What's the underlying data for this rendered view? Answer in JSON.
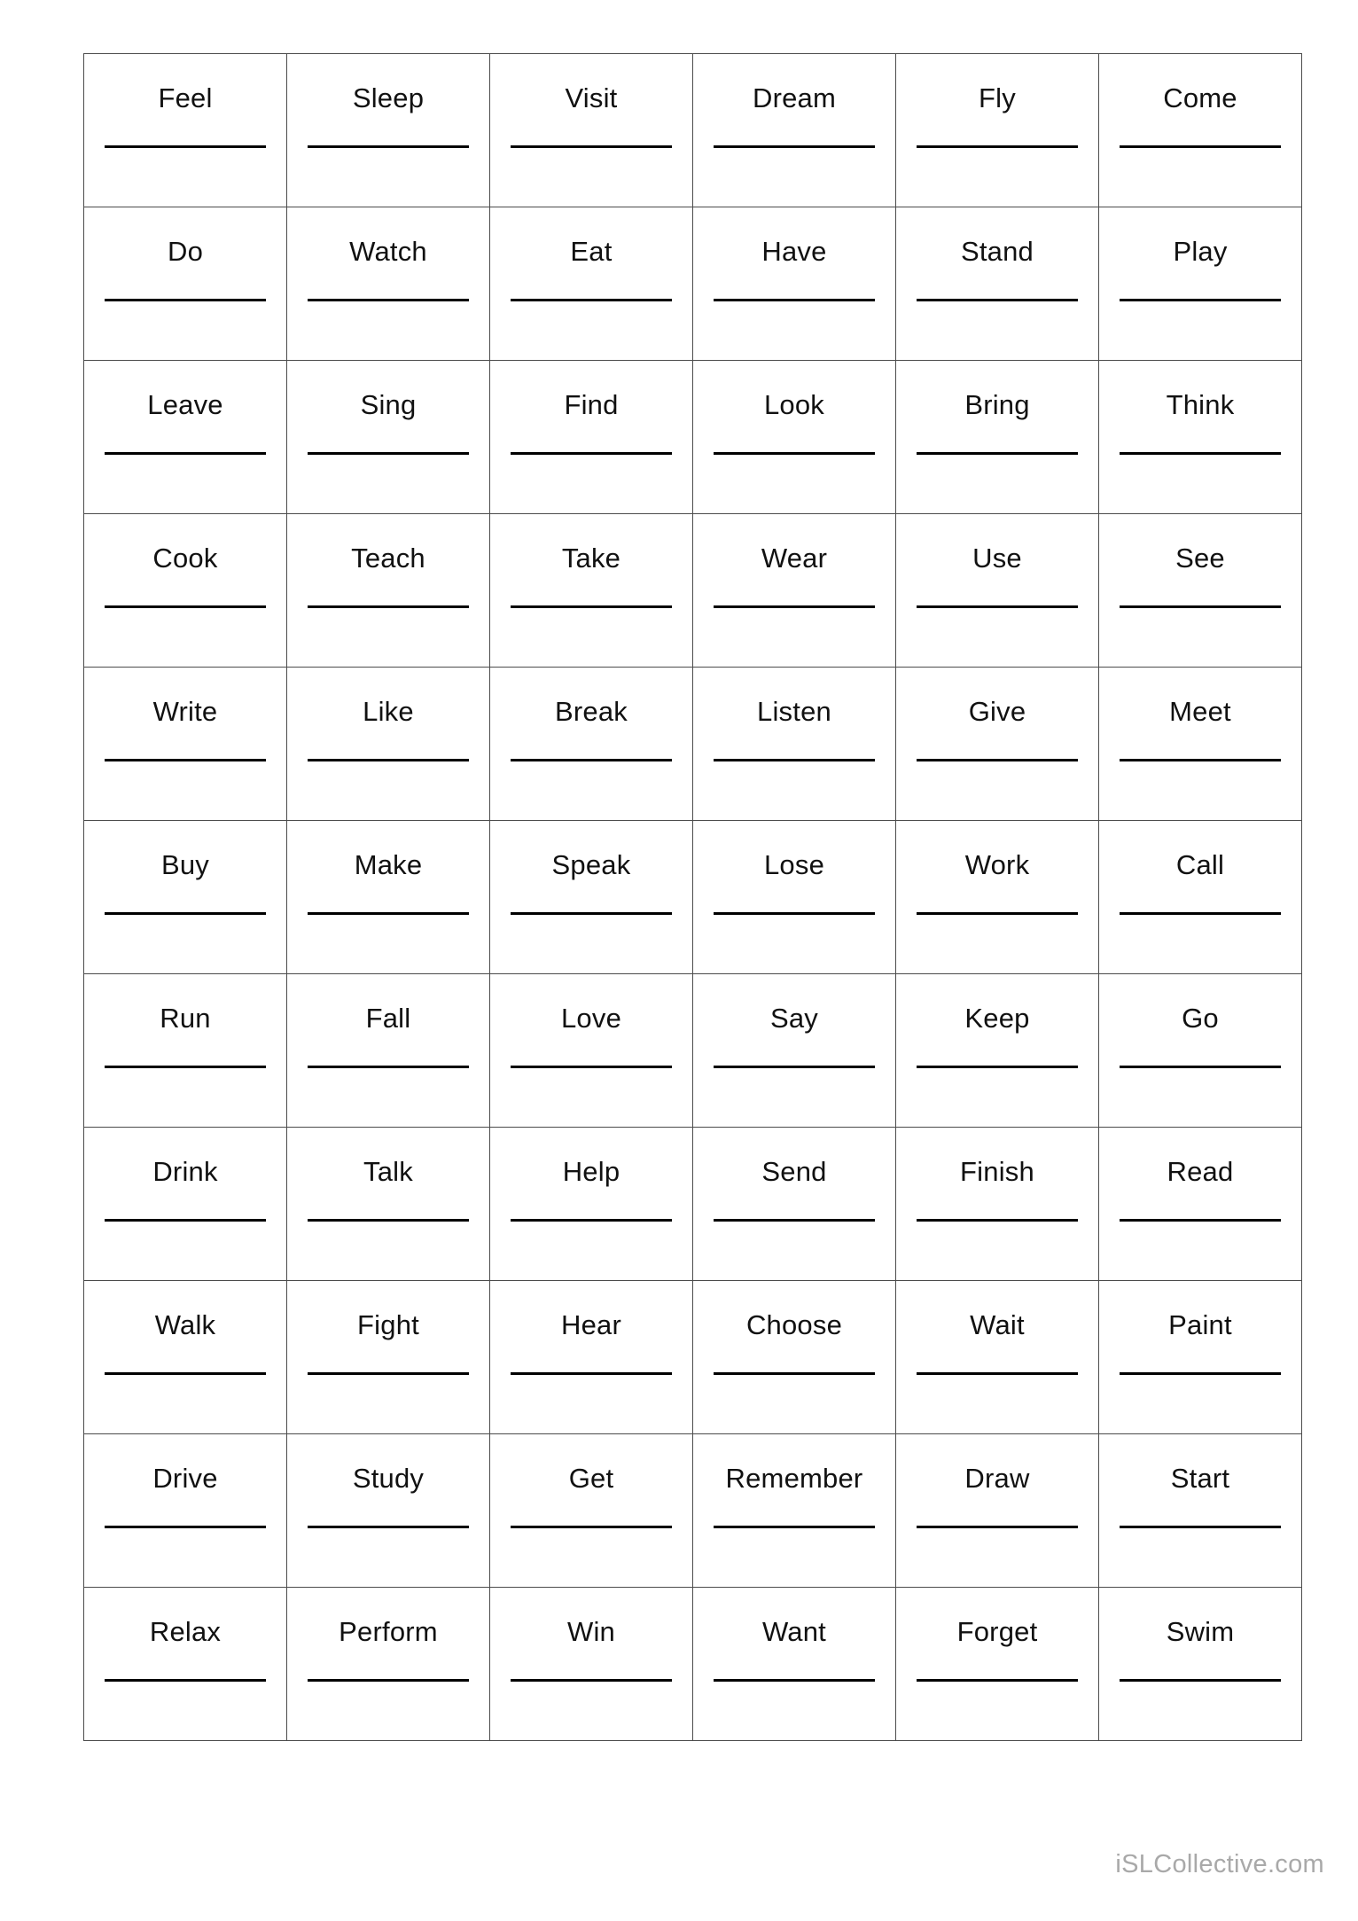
{
  "worksheet": {
    "watermark": "iSLCollective.com",
    "columns": 6,
    "grid": [
      [
        "Feel",
        "Sleep",
        "Visit",
        "Dream",
        "Fly",
        "Come"
      ],
      [
        "Do",
        "Watch",
        "Eat",
        "Have",
        "Stand",
        "Play"
      ],
      [
        "Leave",
        "Sing",
        "Find",
        "Look",
        "Bring",
        "Think"
      ],
      [
        "Cook",
        "Teach",
        "Take",
        "Wear",
        "Use",
        "See"
      ],
      [
        "Write",
        "Like",
        "Break",
        "Listen",
        "Give",
        "Meet"
      ],
      [
        "Buy",
        "Make",
        "Speak",
        "Lose",
        "Work",
        "Call"
      ],
      [
        "Run",
        "Fall",
        "Love",
        "Say",
        "Keep",
        "Go"
      ],
      [
        "Drink",
        "Talk",
        "Help",
        "Send",
        "Finish",
        "Read"
      ],
      [
        "Walk",
        "Fight",
        "Hear",
        "Choose",
        "Wait",
        "Paint"
      ],
      [
        "Drive",
        "Study",
        "Get",
        "Remember",
        "Draw",
        "Start"
      ],
      [
        "Relax",
        "Perform",
        "Win",
        "Want",
        "Forget",
        "Swim"
      ]
    ]
  }
}
